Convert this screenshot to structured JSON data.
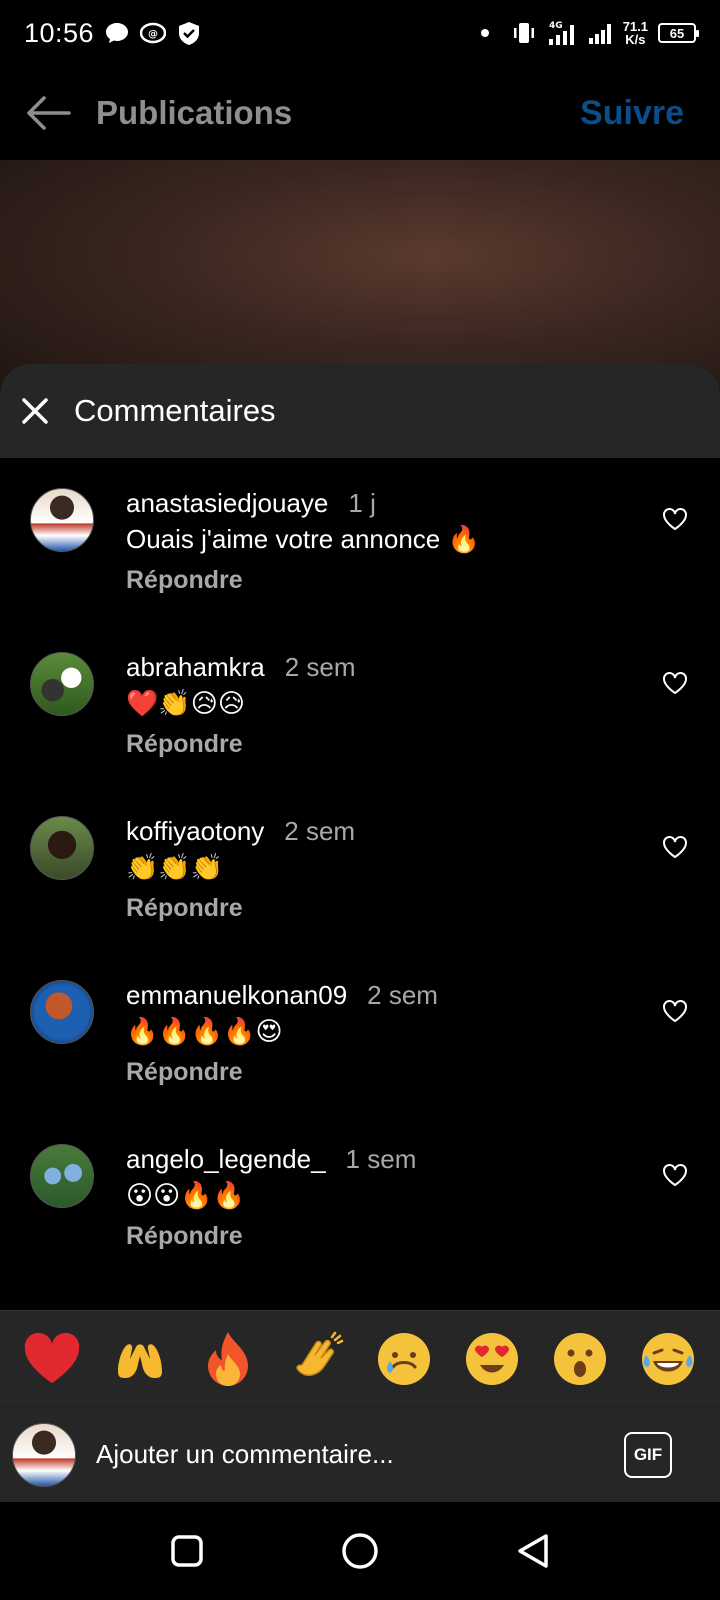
{
  "status_bar": {
    "time": "10:56",
    "net_speed_value": "71.1",
    "net_speed_unit": "K/s",
    "network": "4G",
    "battery": "65"
  },
  "header": {
    "title": "Publications",
    "follow_label": "Suivre"
  },
  "sheet": {
    "title": "Commentaires"
  },
  "comments": [
    {
      "user": "anastasiedjouaye",
      "time": "1 j",
      "text": "Ouais j'aime votre annonce 🔥",
      "reply": "Répondre"
    },
    {
      "user": "abrahamkra",
      "time": "2 sem",
      "text": "❤️👏😥😥",
      "reply": "Répondre"
    },
    {
      "user": "koffiyaotony",
      "time": "2 sem",
      "text": "👏👏👏",
      "reply": "Répondre"
    },
    {
      "user": "emmanuelkonan09",
      "time": "2 sem",
      "text": "🔥🔥🔥🔥😍",
      "reply": "Répondre"
    },
    {
      "user": "angelo_legende_",
      "time": "1 sem",
      "text": "😮😮🔥🔥",
      "reply": "Répondre"
    }
  ],
  "reactions": [
    "❤️",
    "🙌",
    "🔥",
    "👏",
    "😢",
    "😍",
    "😮",
    "😂"
  ],
  "input": {
    "placeholder": "Ajouter un commentaire...",
    "gif_label": "GIF"
  },
  "colors": {
    "follow": "#0a4d8a",
    "sheet_header": "#262626",
    "muted_text": "#a8a8a8"
  }
}
